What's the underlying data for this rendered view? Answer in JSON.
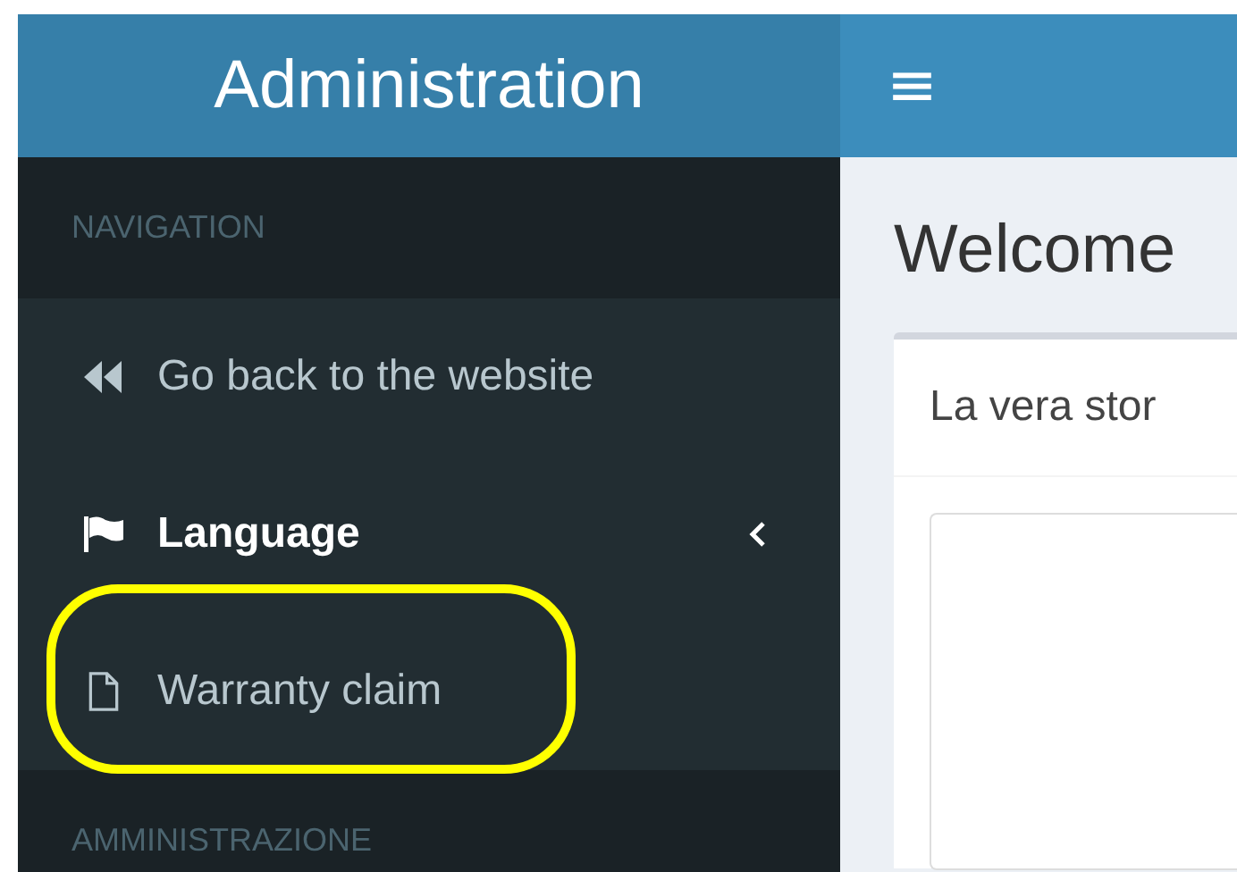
{
  "header": {
    "brand": "Administration",
    "menu_toggle": "≡"
  },
  "sidebar": {
    "sections": [
      {
        "heading": "NAVIGATION",
        "items": [
          {
            "kind": "back",
            "label": "Go back to the website",
            "selected": false,
            "highlighted": false
          },
          {
            "kind": "language",
            "label": "Language",
            "selected": true,
            "highlighted": false,
            "expanded": false
          },
          {
            "kind": "page",
            "label": "Warranty claim",
            "selected": false,
            "highlighted": true
          }
        ]
      },
      {
        "heading": "AMMINISTRAZIONE"
      }
    ]
  },
  "content": {
    "title": "Welcome",
    "card": {
      "title": "La vera stor"
    }
  }
}
